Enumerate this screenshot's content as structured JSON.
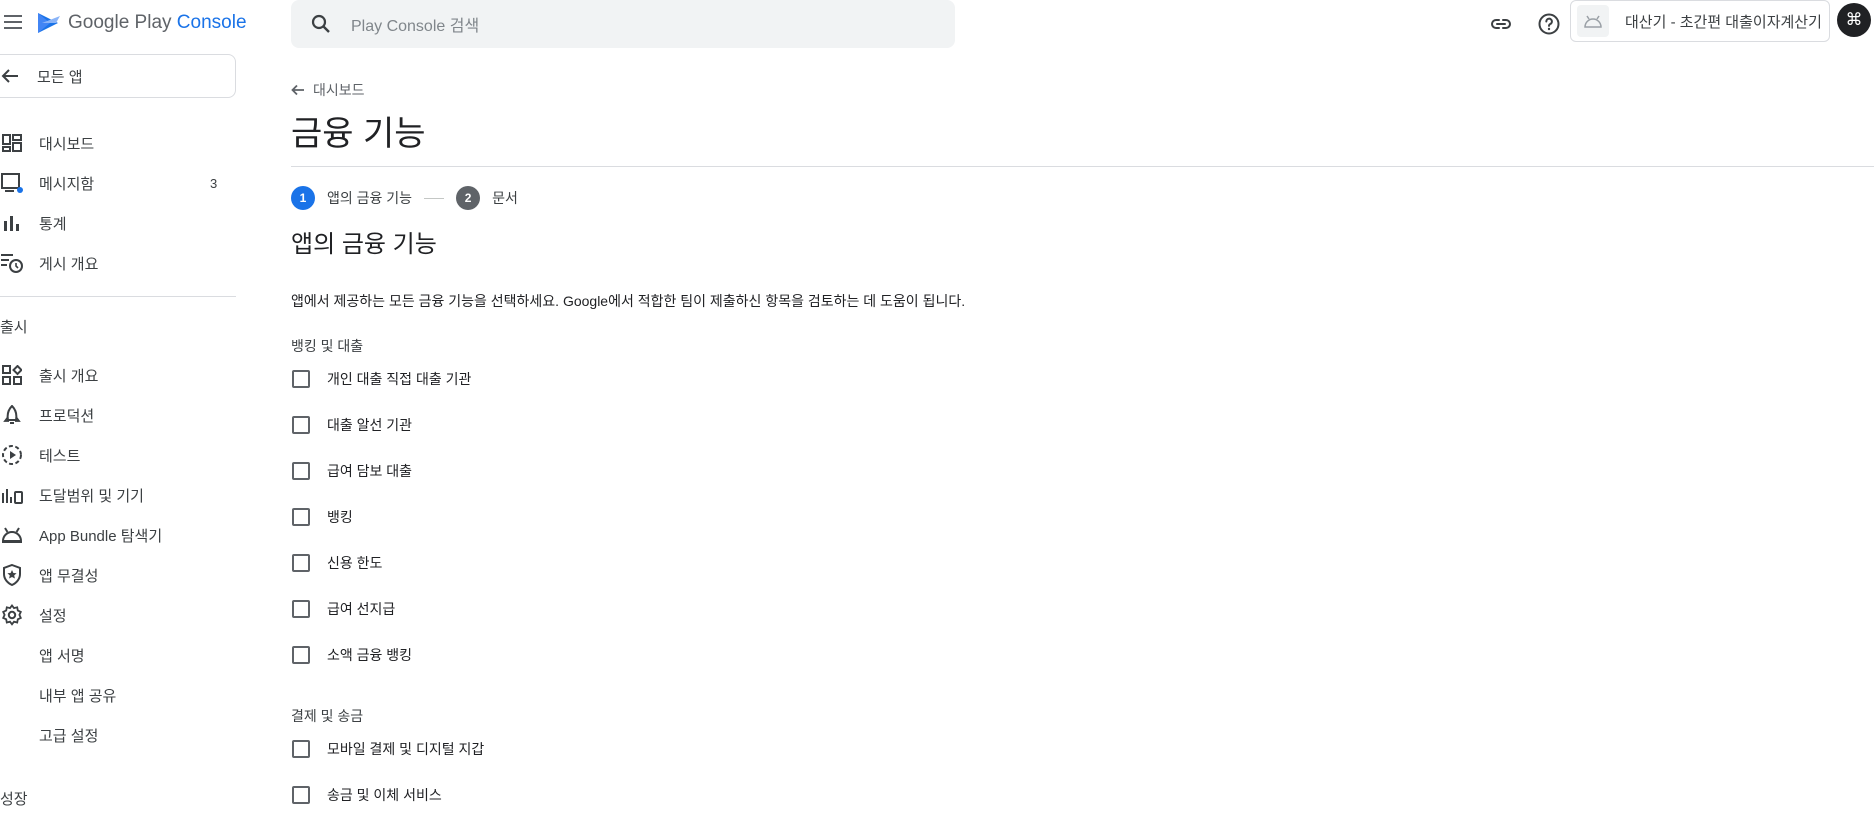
{
  "topbar": {
    "logo_text_main": "Google Play",
    "logo_text_accent": "Console",
    "search_placeholder": "Play Console 검색",
    "app_name": "대산기 - 초간편 대출이자계산기",
    "shortcut_glyph": "⌘"
  },
  "sidebar": {
    "all_apps_label": "모든 앱",
    "items": [
      {
        "label": "대시보드",
        "icon": "dashboard-icon"
      },
      {
        "label": "메시지함",
        "icon": "inbox-icon",
        "badge": "3"
      },
      {
        "label": "통계",
        "icon": "bar-chart-icon"
      },
      {
        "label": "게시 개요",
        "icon": "publishing-overview-icon"
      }
    ],
    "release_section": "출시",
    "release_items": [
      {
        "label": "출시 개요",
        "icon": "release-overview-icon"
      },
      {
        "label": "프로덕션",
        "icon": "production-icon"
      },
      {
        "label": "테스트",
        "icon": "testing-icon"
      },
      {
        "label": "도달범위 및 기기",
        "icon": "reach-devices-icon"
      },
      {
        "label": "App Bundle 탐색기",
        "icon": "android-icon"
      },
      {
        "label": "앱 무결성",
        "icon": "shield-star-icon"
      },
      {
        "label": "설정",
        "icon": "gear-icon"
      }
    ],
    "settings_subitems": [
      "앱 서명",
      "내부 앱 공유",
      "고급 설정"
    ],
    "growth_section": "성장"
  },
  "main": {
    "breadcrumb": "대시보드",
    "page_title": "금융 기능",
    "steps": [
      {
        "number": "1",
        "label": "앱의 금융 기능"
      },
      {
        "number": "2",
        "label": "문서"
      }
    ],
    "section_title": "앱의 금융 기능",
    "description": "앱에서 제공하는 모든 금융 기능을 선택하세요. Google에서 적합한 팀이 제출하신 항목을 검토하는 데 도움이 됩니다.",
    "groups": [
      {
        "title": "뱅킹 및 대출",
        "options": [
          "개인 대출 직접 대출 기관",
          "대출 알선 기관",
          "급여 담보 대출",
          "뱅킹",
          "신용 한도",
          "급여 선지급",
          "소액 금융 뱅킹"
        ]
      },
      {
        "title": "결제 및 송금",
        "options": [
          "모바일 결제 및 디지털 지갑",
          "송금 및 이체 서비스"
        ]
      }
    ]
  },
  "colors": {
    "accent": "#1a73e8",
    "text": "#202124",
    "secondary_text": "#5f6368",
    "divider": "#dadce0"
  }
}
